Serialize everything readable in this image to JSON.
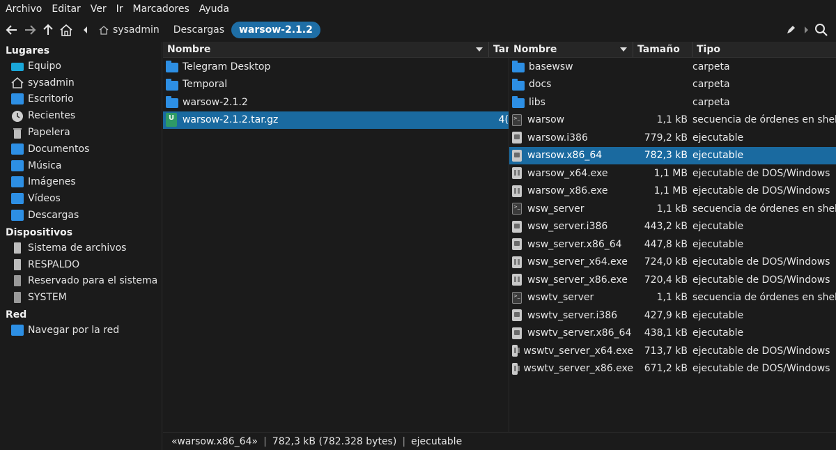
{
  "menu": [
    "Archivo",
    "Editar",
    "Ver",
    "Ir",
    "Marcadores",
    "Ayuda"
  ],
  "breadcrumb": {
    "items": [
      "sysadmin",
      "Descargas",
      "warsow-2.1.2"
    ],
    "active": "warsow-2.1.2"
  },
  "sidebar": {
    "sections": [
      {
        "title": "Lugares",
        "items": [
          {
            "label": "Equipo",
            "icon": "computer-icon"
          },
          {
            "label": "sysadmin",
            "icon": "home-icon"
          },
          {
            "label": "Escritorio",
            "icon": "desktop-folder-icon"
          },
          {
            "label": "Recientes",
            "icon": "clock-icon"
          },
          {
            "label": "Papelera",
            "icon": "trash-icon"
          },
          {
            "label": "Documentos",
            "icon": "documents-folder-icon"
          },
          {
            "label": "Música",
            "icon": "music-folder-icon"
          },
          {
            "label": "Imágenes",
            "icon": "pictures-folder-icon"
          },
          {
            "label": "Vídeos",
            "icon": "videos-folder-icon"
          },
          {
            "label": "Descargas",
            "icon": "downloads-folder-icon"
          }
        ]
      },
      {
        "title": "Dispositivos",
        "items": [
          {
            "label": "Sistema de archivos",
            "icon": "drive-icon"
          },
          {
            "label": "RESPALDO",
            "icon": "drive-icon"
          },
          {
            "label": "Reservado para el sistema",
            "icon": "drive-icon"
          },
          {
            "label": "SYSTEM",
            "icon": "drive-icon"
          }
        ]
      },
      {
        "title": "Red",
        "items": [
          {
            "label": "Navegar por la red",
            "icon": "network-folder-icon"
          }
        ]
      }
    ]
  },
  "left_pane": {
    "headers": {
      "name": "Nombre",
      "size": "Tam"
    },
    "rows": [
      {
        "name": "Telegram Desktop",
        "type": "folder",
        "size": ""
      },
      {
        "name": "Temporal",
        "type": "folder",
        "size": ""
      },
      {
        "name": "warsow-2.1.2",
        "type": "folder",
        "size": ""
      },
      {
        "name": "warsow-2.1.2.tar.gz",
        "type": "archive",
        "size": "4(",
        "selected": true
      }
    ]
  },
  "right_pane": {
    "headers": {
      "name": "Nombre",
      "size": "Tamaño",
      "type": "Tipo"
    },
    "rows": [
      {
        "name": "basewsw",
        "icon": "folder",
        "size": "",
        "type": "carpeta"
      },
      {
        "name": "docs",
        "icon": "folder",
        "size": "",
        "type": "carpeta"
      },
      {
        "name": "libs",
        "icon": "folder",
        "size": "",
        "type": "carpeta"
      },
      {
        "name": "warsow",
        "icon": "sh",
        "size": "1,1 kB",
        "type": "secuencia de órdenes en shell"
      },
      {
        "name": "warsow.i386",
        "icon": "bin",
        "size": "779,2 kB",
        "type": "ejecutable"
      },
      {
        "name": "warsow.x86_64",
        "icon": "bin",
        "size": "782,3 kB",
        "type": "ejecutable",
        "selected": true
      },
      {
        "name": "warsow_x64.exe",
        "icon": "exe",
        "size": "1,1 MB",
        "type": "ejecutable de DOS/Windows"
      },
      {
        "name": "warsow_x86.exe",
        "icon": "exe",
        "size": "1,1 MB",
        "type": "ejecutable de DOS/Windows"
      },
      {
        "name": "wsw_server",
        "icon": "sh",
        "size": "1,1 kB",
        "type": "secuencia de órdenes en shell"
      },
      {
        "name": "wsw_server.i386",
        "icon": "bin",
        "size": "443,2 kB",
        "type": "ejecutable"
      },
      {
        "name": "wsw_server.x86_64",
        "icon": "bin",
        "size": "447,8 kB",
        "type": "ejecutable"
      },
      {
        "name": "wsw_server_x64.exe",
        "icon": "exe",
        "size": "724,0 kB",
        "type": "ejecutable de DOS/Windows"
      },
      {
        "name": "wsw_server_x86.exe",
        "icon": "exe",
        "size": "720,4 kB",
        "type": "ejecutable de DOS/Windows"
      },
      {
        "name": "wswtv_server",
        "icon": "sh",
        "size": "1,1 kB",
        "type": "secuencia de órdenes en shell"
      },
      {
        "name": "wswtv_server.i386",
        "icon": "bin",
        "size": "427,9 kB",
        "type": "ejecutable"
      },
      {
        "name": "wswtv_server.x86_64",
        "icon": "bin",
        "size": "438,1 kB",
        "type": "ejecutable"
      },
      {
        "name": "wswtv_server_x64.exe",
        "icon": "exe",
        "size": "713,7 kB",
        "type": "ejecutable de DOS/Windows"
      },
      {
        "name": "wswtv_server_x86.exe",
        "icon": "exe",
        "size": "671,2 kB",
        "type": "ejecutable de DOS/Windows"
      }
    ]
  },
  "status": {
    "name": "«warsow.x86_64»",
    "size": "782,3 kB (782.328 bytes)",
    "type": "ejecutable"
  },
  "colors": {
    "accent": "#1e6ea6",
    "folder": "#2d8fe4",
    "background": "#1b1b1b"
  }
}
